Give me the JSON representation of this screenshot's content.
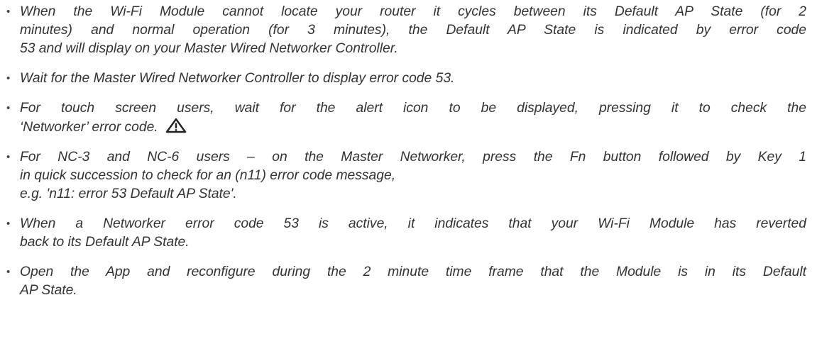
{
  "items": [
    {
      "lines": [
        "When the Wi-Fi Module cannot locate your router it cycles between its Default AP State (for 2",
        "minutes) and normal operation (for 3 minutes), the Default AP State is indicated by error code",
        "53 and will display on your Master Wired Networker Controller."
      ]
    },
    {
      "lines": [
        "Wait for the Master Wired Networker Controller to display error code 53."
      ]
    },
    {
      "lines": [
        "For touch screen users, wait for the alert icon to be displayed, pressing it to check the",
        "‘Networker’ error code."
      ],
      "icon": "warning-triangle-icon"
    },
    {
      "lines": [
        "For NC-3 and NC-6 users – on the Master Networker, press the Fn button followed by Key 1",
        "in quick succession to check for an (n11) error code message,",
        "e.g. 'n11: error 53 Default AP State'."
      ]
    },
    {
      "lines": [
        "When a Networker error code 53 is active, it indicates that your Wi-Fi Module has reverted",
        "back to its Default AP State."
      ]
    },
    {
      "lines": [
        "Open the App and reconfigure during the 2 minute time frame that the Module is in its Default",
        "AP State."
      ]
    }
  ]
}
